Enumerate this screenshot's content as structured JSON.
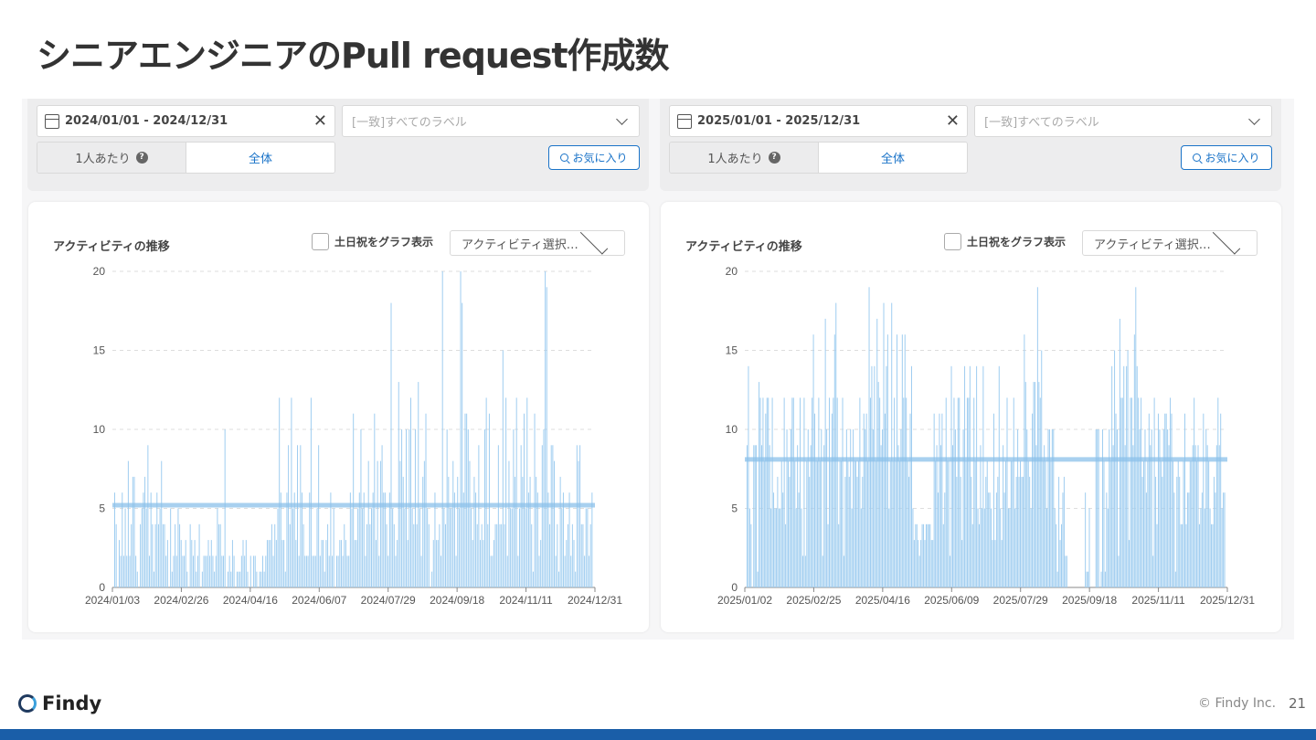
{
  "title": "シニアエンジニアのPull request作成数",
  "colors": {
    "accent": "#1a73c8",
    "bar": "#9fcdf0",
    "avg": "#8cc1ea",
    "footer_bar": "#1a5ea8"
  },
  "icons": {
    "calendar": "calendar-icon",
    "clear": "close-icon",
    "dropdown": "chevron-down-icon",
    "help": "question-icon",
    "search": "search-icon"
  },
  "panels": [
    {
      "filters": {
        "date_range": "2024/01/01 - 2024/12/31",
        "clear_glyph": "✕",
        "label_placeholder": "[一致]すべてのラベル",
        "per_person_label": "1人あたり",
        "help_glyph": "?",
        "all_label": "全体",
        "favorites_label": "お気に入り"
      },
      "chart_header": {
        "title": "アクティビティの推移",
        "weekend_label": "土日祝をグラフ表示",
        "activity_select": "アクティビティ選択…"
      }
    },
    {
      "filters": {
        "date_range": "2025/01/01 - 2025/12/31",
        "clear_glyph": "✕",
        "label_placeholder": "[一致]すべてのラベル",
        "per_person_label": "1人あたり",
        "help_glyph": "?",
        "all_label": "全体",
        "favorites_label": "お気に入り"
      },
      "chart_header": {
        "title": "アクティビティの推移",
        "weekend_label": "土日祝をグラフ表示",
        "activity_select": "アクティビティ選択…"
      }
    }
  ],
  "chart_data": [
    {
      "type": "bar",
      "x_range": [
        "2024-01-03",
        "2024-12-31"
      ],
      "tick_labels": [
        "2024/01/03",
        "2024/02/26",
        "2024/04/16",
        "2024/06/07",
        "2024/07/29",
        "2024/09/18",
        "2024/11/11",
        "2024/12/31"
      ],
      "yticks": [
        0,
        5,
        10,
        15,
        20
      ],
      "ylim": [
        0,
        20
      ],
      "grid": true,
      "average": 5.2,
      "values": [
        6,
        4,
        0,
        3,
        2,
        6,
        2,
        5,
        2,
        8,
        2,
        4,
        7,
        7,
        2,
        1,
        0,
        4,
        5,
        6,
        7,
        5,
        9,
        2,
        6,
        4,
        1,
        4,
        6,
        4,
        5,
        8,
        4,
        4,
        2,
        3,
        0,
        5,
        1,
        2,
        4,
        2,
        5,
        4,
        3,
        2,
        2,
        3,
        1,
        0,
        4,
        3,
        2,
        3,
        1,
        2,
        4,
        0,
        1,
        2,
        2,
        2,
        3,
        2,
        3,
        2,
        1,
        2,
        5,
        4,
        4,
        2,
        2,
        10,
        0,
        1,
        2,
        1,
        3,
        2,
        0,
        1,
        1,
        1,
        2,
        3,
        2,
        3,
        1,
        0,
        2,
        0,
        2,
        2,
        1,
        0,
        1,
        1,
        2,
        1,
        2,
        3,
        3,
        3,
        4,
        2,
        4,
        3,
        5,
        12,
        6,
        3,
        3,
        1,
        6,
        9,
        4,
        12,
        5,
        6,
        3,
        9,
        2,
        9,
        6,
        4,
        2,
        2,
        2,
        6,
        12,
        2,
        2,
        2,
        5,
        9,
        2,
        3,
        3,
        1,
        3,
        4,
        2,
        6,
        2,
        5,
        0,
        2,
        2,
        3,
        3,
        2,
        4,
        3,
        2,
        2,
        6,
        5,
        11,
        3,
        3,
        5,
        6,
        10,
        5,
        6,
        2,
        4,
        8,
        4,
        5,
        6,
        11,
        3,
        8,
        2,
        8,
        9,
        6,
        6,
        4,
        2,
        6,
        18,
        5,
        4,
        2,
        3,
        13,
        8,
        10,
        7,
        5,
        10,
        3,
        10,
        12,
        5,
        4,
        10,
        4,
        13,
        5,
        2,
        7,
        8,
        11,
        5,
        4,
        0,
        1,
        3,
        6,
        3,
        3,
        4,
        2,
        20,
        5,
        4,
        10,
        7,
        5,
        5,
        8,
        6,
        2,
        7,
        5,
        20,
        18,
        6,
        11,
        11,
        10,
        8,
        5,
        3,
        7,
        6,
        4,
        9,
        3,
        4,
        3,
        10,
        12,
        4,
        11,
        2,
        2,
        3,
        4,
        4,
        9,
        4,
        4,
        15,
        4,
        12,
        2,
        8,
        5,
        5,
        10,
        7,
        12,
        2,
        5,
        9,
        7,
        11,
        5,
        12,
        6,
        7,
        4,
        1,
        11,
        7,
        6,
        2,
        3,
        9,
        10,
        20,
        19,
        6,
        4,
        9,
        9,
        8,
        2,
        4,
        1,
        7,
        5,
        6,
        2,
        3,
        4,
        6,
        2,
        4,
        3,
        1,
        9,
        8,
        9,
        4,
        4,
        2,
        5,
        5,
        2,
        4,
        6
      ]
    },
    {
      "type": "bar",
      "x_range": [
        "2025-01-02",
        "2025-12-31"
      ],
      "tick_labels": [
        "2025/01/02",
        "2025/02/25",
        "2025/04/16",
        "2025/06/09",
        "2025/07/29",
        "2025/09/18",
        "2025/11/11",
        "2025/12/31"
      ],
      "yticks": [
        0,
        5,
        10,
        15,
        20
      ],
      "ylim": [
        0,
        20
      ],
      "grid": true,
      "average": 8.1,
      "values": [
        9,
        14,
        5,
        4,
        0,
        9,
        9,
        9,
        1,
        13,
        12,
        9,
        12,
        8,
        11,
        12,
        12,
        9,
        5,
        12,
        6,
        5,
        5,
        7,
        5,
        5,
        8,
        6,
        12,
        4,
        10,
        8,
        7,
        10,
        12,
        12,
        8,
        5,
        9,
        6,
        12,
        5,
        2,
        12,
        2,
        8,
        10,
        7,
        9,
        12,
        16,
        11,
        8,
        8,
        12,
        8,
        10,
        2,
        9,
        17,
        10,
        4,
        12,
        8,
        11,
        12,
        16,
        18,
        12,
        4,
        8,
        8,
        12,
        2,
        7,
        10,
        8,
        7,
        10,
        5,
        10,
        8,
        8,
        7,
        8,
        12,
        5,
        7,
        11,
        10,
        11,
        8,
        19,
        12,
        14,
        10,
        14,
        8,
        17,
        13,
        12,
        9,
        10,
        18,
        11,
        14,
        16,
        5,
        8,
        18,
        8,
        12,
        8,
        16,
        9,
        8,
        10,
        16,
        12,
        16,
        12,
        8,
        7,
        11,
        14,
        5,
        3,
        4,
        4,
        3,
        2,
        3,
        4,
        4,
        3,
        4,
        4,
        4,
        4,
        3,
        3,
        11,
        8,
        9,
        6,
        11,
        9,
        11,
        4,
        6,
        12,
        8,
        8,
        2,
        14,
        9,
        12,
        10,
        7,
        12,
        12,
        7,
        3,
        10,
        14,
        8,
        12,
        12,
        14,
        7,
        4,
        12,
        8,
        14,
        5,
        4,
        9,
        5,
        14,
        5,
        7,
        8,
        6,
        6,
        5,
        3,
        11,
        3,
        6,
        7,
        14,
        5,
        3,
        9,
        6,
        8,
        12,
        5,
        5,
        8,
        8,
        12,
        5,
        7,
        10,
        7,
        8,
        7,
        7,
        16,
        13,
        10,
        8,
        7,
        5,
        11,
        13,
        13,
        9,
        19,
        13,
        12,
        15,
        8,
        9,
        8,
        5,
        10,
        10,
        8,
        10,
        10,
        5,
        4,
        1,
        7,
        3,
        4,
        6,
        7,
        2,
        2,
        0,
        0,
        0,
        0,
        0,
        0,
        0,
        0,
        0,
        0,
        0,
        0,
        0,
        6,
        1,
        1,
        5,
        0,
        0,
        0,
        0,
        10,
        10,
        10,
        0,
        1,
        10,
        8,
        1,
        6,
        5,
        10,
        8,
        14,
        9,
        15,
        11,
        10,
        2,
        17,
        12,
        12,
        14,
        9,
        14,
        15,
        3,
        12,
        12,
        9,
        16,
        19,
        14,
        12,
        10,
        12,
        7,
        8,
        10,
        6,
        8,
        11,
        9,
        10,
        2,
        12,
        7,
        4,
        11,
        10,
        8,
        7,
        10,
        11,
        11,
        10,
        9,
        12,
        11,
        8,
        6,
        1,
        7,
        8,
        7,
        4,
        4,
        8,
        11,
        4,
        6,
        6,
        8,
        8,
        9,
        12,
        9,
        8,
        9,
        4,
        5,
        6,
        11,
        5,
        10,
        9,
        8,
        5,
        4,
        4,
        7,
        6,
        9,
        12,
        9,
        11,
        5,
        6,
        6
      ]
    }
  ],
  "footer": {
    "brand": "Findy",
    "copyright": "© Findy Inc.",
    "page_number": "21"
  }
}
